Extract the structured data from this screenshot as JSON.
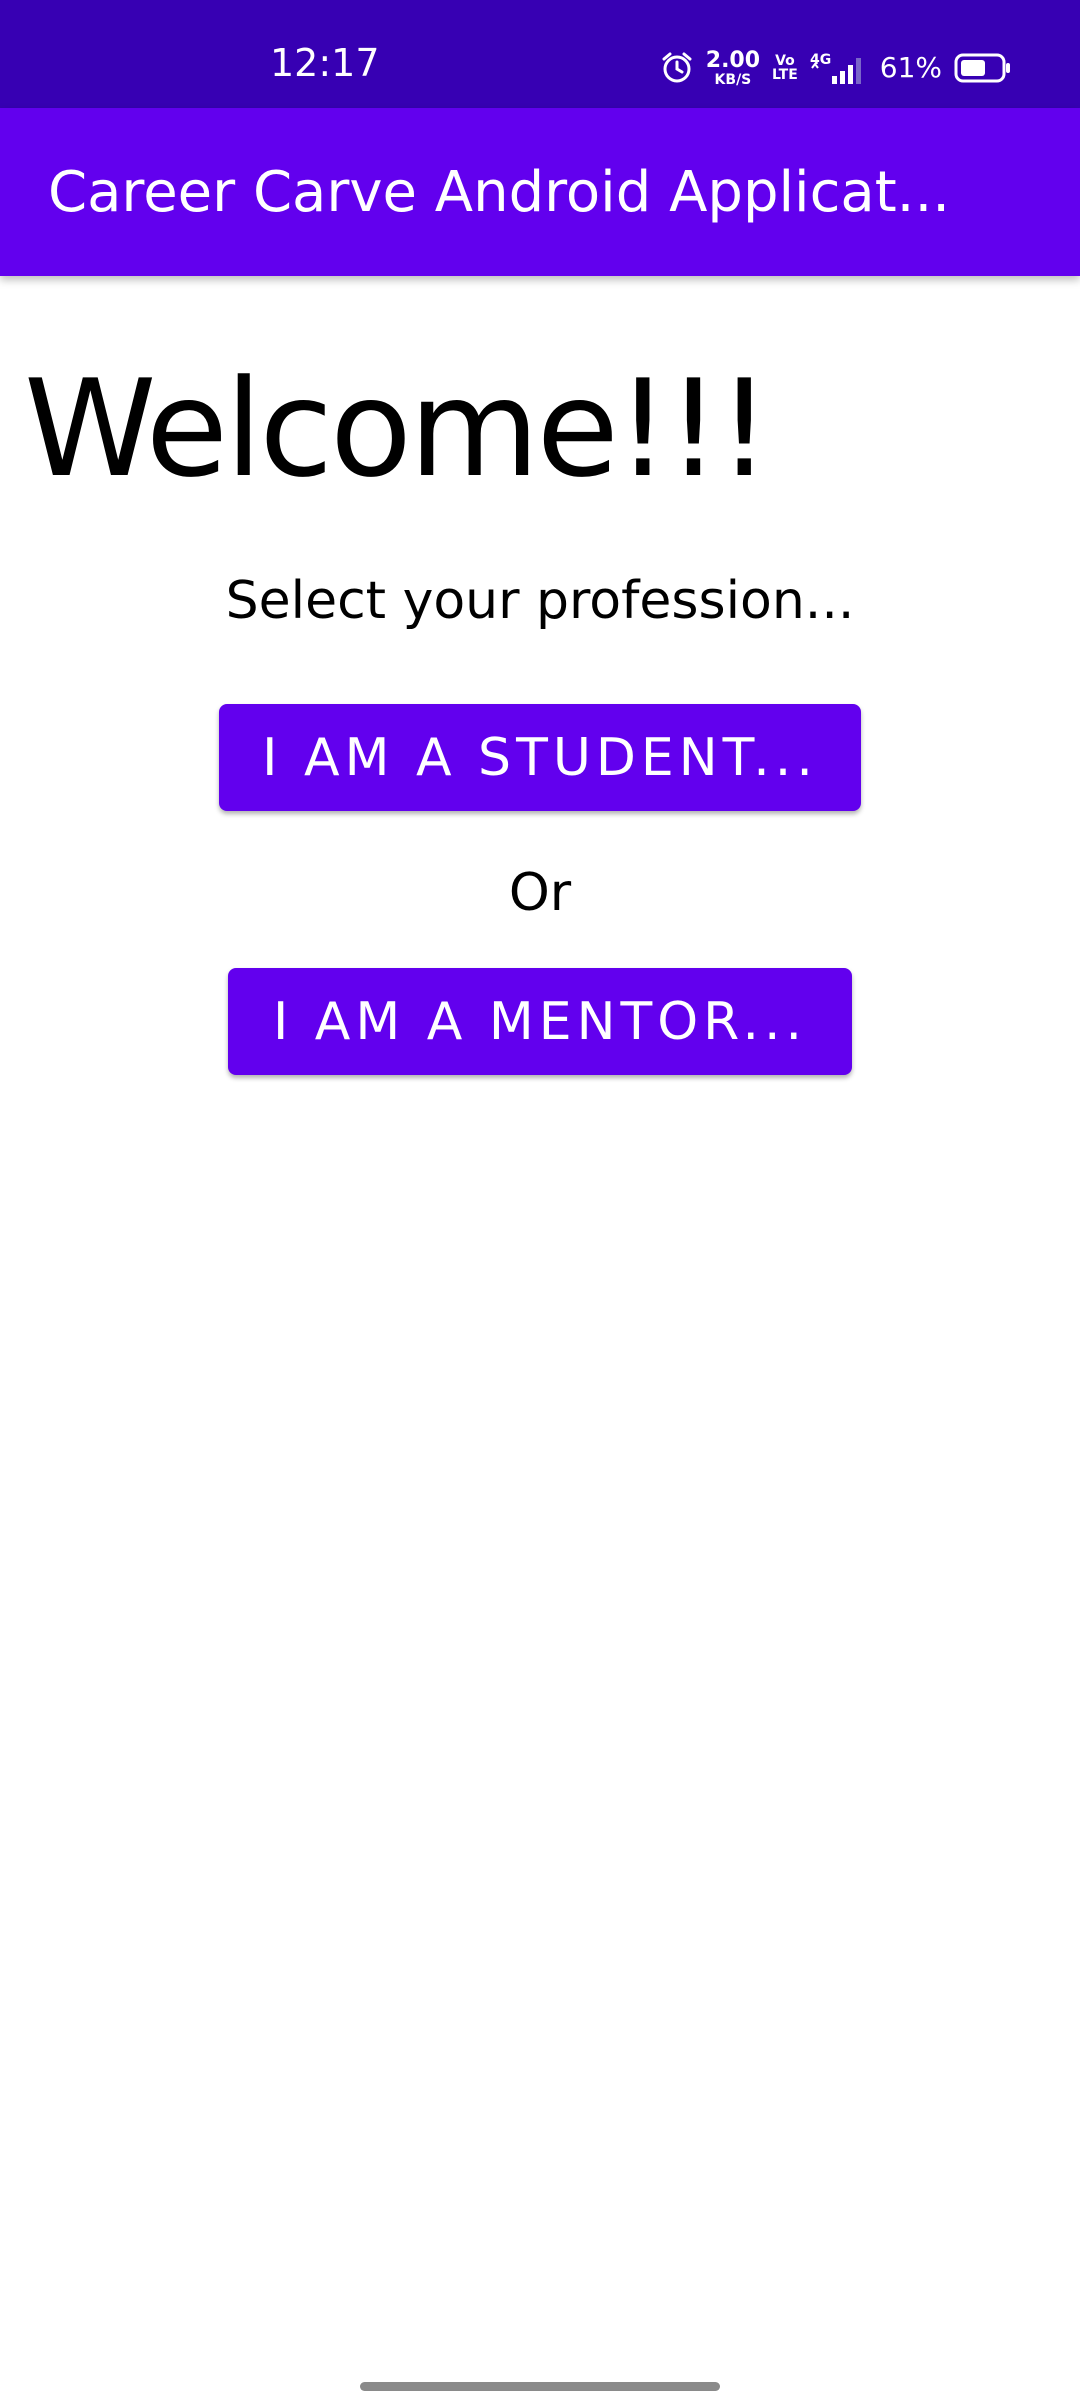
{
  "status_bar": {
    "time": "12:17",
    "net_speed_value": "2.00",
    "net_speed_unit": "KB/S",
    "volte_top": "Vo",
    "volte_bottom": "LTE",
    "network_type": "4G",
    "battery_percent": "61%",
    "icons": [
      "alarm-icon",
      "signal-icon",
      "battery-icon"
    ]
  },
  "app_bar": {
    "title": "Career Carve Android Applicat..."
  },
  "main": {
    "welcome": "Welcome!!!",
    "subtitle": "Select your profession...",
    "student_button": "I AM A STUDENT...",
    "or_text": "Or",
    "mentor_button": "I AM A MENTOR..."
  },
  "colors": {
    "status_bar": "#3700b3",
    "primary": "#6200ee",
    "background": "#ffffff",
    "text": "#000000"
  }
}
